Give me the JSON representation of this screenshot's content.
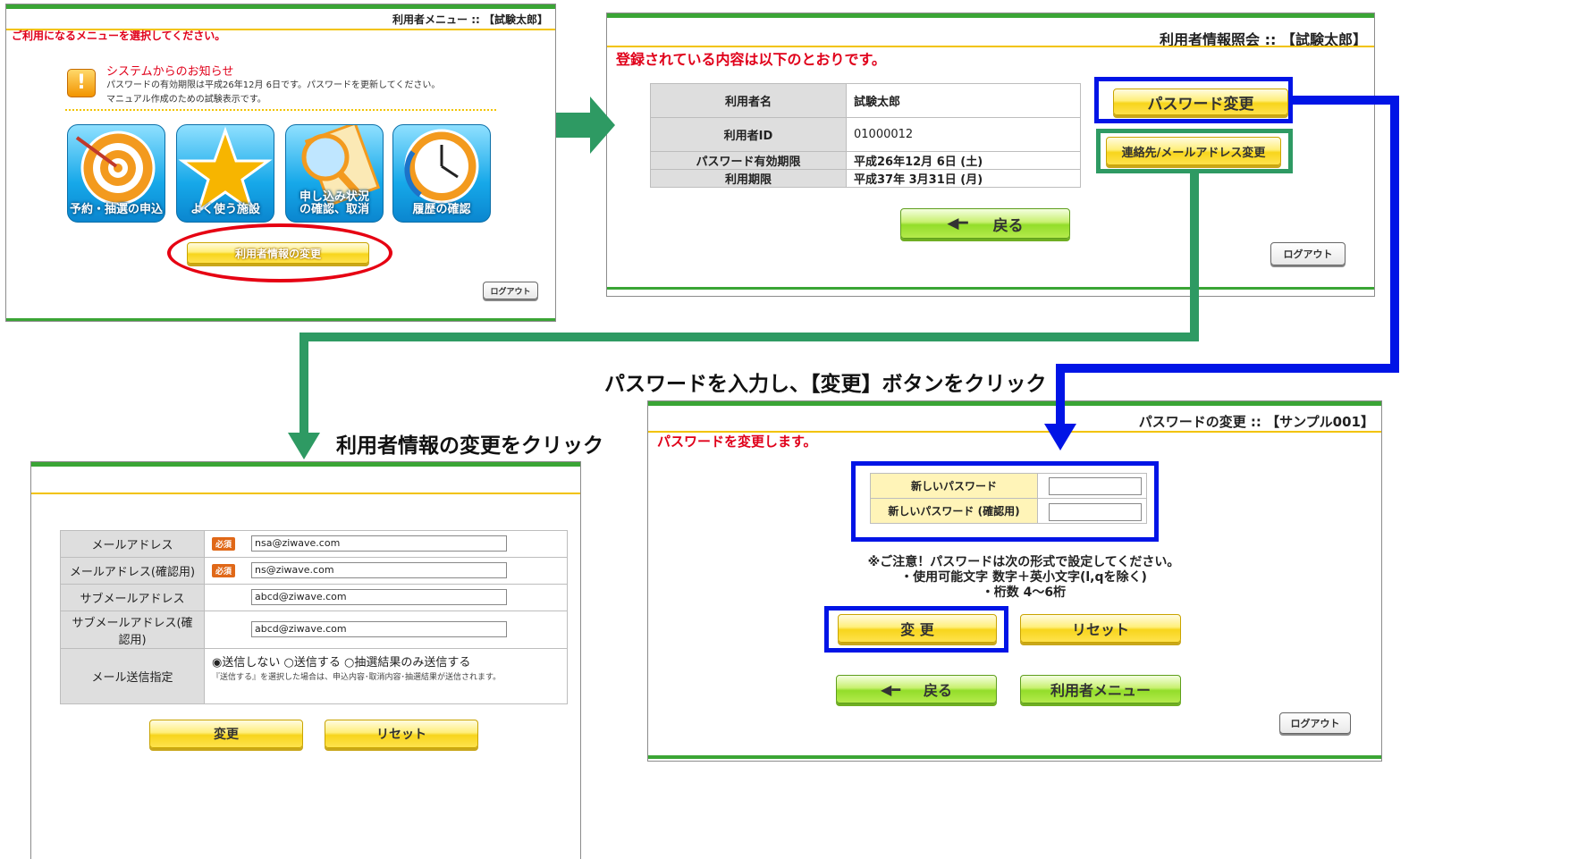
{
  "flow": {
    "caption_user_info": "利用者情報の変更をクリック",
    "caption_password": "パスワードを入力し、【変更】ボタンをクリック"
  },
  "panel_menu": {
    "title": "利用者メニュー :: 【試験太郎】",
    "prompt": "ご利用になるメニューを選択してください。",
    "notice_title": "システムからのお知らせ",
    "notice_line1": "パスワードの有効期限は平成26年12月 6日です。パスワードを更新してください。",
    "notice_line2": "マニュアル作成のための試験表示です。",
    "tiles": [
      {
        "label": "予約・抽選の申込",
        "icon": "target-icon"
      },
      {
        "label": "よく使う施設",
        "icon": "star-icon"
      },
      {
        "label": "申し込み状況の確認、取消",
        "icon": "magnifier-icon"
      },
      {
        "label": "履歴の確認",
        "icon": "clock-icon"
      }
    ],
    "user_info_button": "利用者情報の変更",
    "logout": "ログアウト"
  },
  "panel_info": {
    "title": "利用者情報照会 :: 【試験太郎】",
    "heading": "登録されている内容は以下のとおりです。",
    "rows": [
      {
        "label": "利用者名",
        "value": "試験太郎"
      },
      {
        "label": "利用者ID",
        "value": "01000012"
      },
      {
        "label": "パスワード有効期限",
        "value": "平成26年12月 6日 (土)"
      },
      {
        "label": "利用期限",
        "value": "平成37年 3月31日 (月)"
      }
    ],
    "password_change": "パスワード変更",
    "contact_change": "連絡先/メールアドレス変更",
    "back": "戻る",
    "logout": "ログアウト"
  },
  "panel_mail": {
    "rows": [
      {
        "label": "メールアドレス",
        "required": "必須",
        "value": "nsa@ziwave.com"
      },
      {
        "label": "メールアドレス(確認用)",
        "required": "必須",
        "value": "ns@ziwave.com"
      },
      {
        "label": "サブメールアドレス",
        "required": "",
        "value": "abcd@ziwave.com"
      },
      {
        "label": "サブメールアドレス(確認用)",
        "required": "",
        "value": "abcd@ziwave.com"
      }
    ],
    "send_label": "メール送信指定",
    "send_options": [
      "送信しない",
      "送信する",
      "抽選結果のみ送信する"
    ],
    "send_selected": "送信しない",
    "send_note": "『送信する』を選択した場合は、申込内容･取消内容･抽選結果が送信されます。",
    "change": "変更",
    "reset": "リセット"
  },
  "panel_password": {
    "title": "パスワードの変更 :: 【サンプル001】",
    "heading": "パスワードを変更します。",
    "new_password": "新しいパスワード",
    "confirm_password": "新しいパスワード (確認用)",
    "note1": "※ご注意！パスワードは次の形式で設定してください。",
    "note2": "・使用可能文字 数字＋英小文字(l,qを除く)",
    "note3": "・桁数 4～6桁",
    "change": "変 更",
    "reset": "リセット",
    "back": "戻る",
    "user_menu": "利用者メニュー",
    "logout": "ログアウト"
  },
  "colors": {
    "arrow_green": "#2e9a63",
    "arrow_blue": "#0014e6",
    "highlight_red": "#e60012"
  }
}
